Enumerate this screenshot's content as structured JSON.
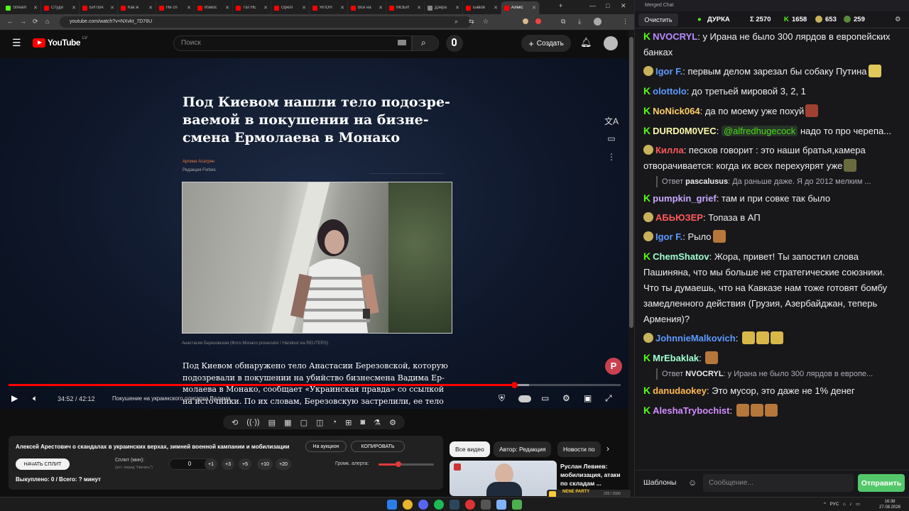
{
  "browser": {
    "tabs": [
      {
        "label": "Stream",
        "color": "#53fc18"
      },
      {
        "label": "Студи",
        "color": "#ff0000"
      },
      {
        "label": "БИТВА",
        "color": "#ff0000"
      },
      {
        "label": "Как ж",
        "color": "#ff0000"
      },
      {
        "label": "Не сп",
        "color": "#ff0000"
      },
      {
        "label": "Измос",
        "color": "#ff0000"
      },
      {
        "label": "ТЫ НЕ",
        "color": "#ff0000"
      },
      {
        "label": "Орелі",
        "color": "#ff0000"
      },
      {
        "label": "ЯПОН",
        "color": "#ff0000"
      },
      {
        "label": "Все на",
        "color": "#ff0000"
      },
      {
        "label": "МОБИ",
        "color": "#ff0000"
      },
      {
        "label": "Дзера",
        "color": "#888888"
      },
      {
        "label": "Бавов",
        "color": "#ff0000"
      },
      {
        "label": "Алекс",
        "color": "#ff0000",
        "active": true
      }
    ],
    "url": "youtube.com/watch?v=NXvkt_7D76U"
  },
  "youtube": {
    "logo_text": "YouTube",
    "logo_region": "LV",
    "search_placeholder": "Поиск",
    "create_label": "Создать"
  },
  "video": {
    "headline": "Под Киевом нашли тело подозре-ваемой в покушении на бизне-смена Ермолаева в Монако",
    "author": "Арпине Асатрян",
    "author_role": "Редакция Forbes",
    "photo_caption": "Анастасия Березовская (Фото Monaco prosecutor / Handout via REUTERS)",
    "body": "Под Киевом обнаружено тело Анастасии Березовской, которую подозревали в покушении на убийство бизнесмена Вадима Ер-молаева в Монако, сообщает «Украинская правда» со ссылкой на источники. По их словам, Березовскую застрелили, ее тело было",
    "badge_letter": "P",
    "time": "34:52 / 42:12",
    "chapter": "Покушение на украинского олигарха Вадима...",
    "progress_fraction": 0.826,
    "buffered_fraction": 0.85
  },
  "split": {
    "title": "Алексей Арестович о скандалах в украинских верхах, зимней военной кампании и мобилизации",
    "auction_label": "На аукцион",
    "copy_label": "КОПИРОВАТЬ",
    "start_label": "НАЧАТЬ СПЛИТ",
    "split_label": "Сплит (мин):",
    "split_hint": "(уст. перед \"Начать\")",
    "split_value": "0",
    "inc_buttons": [
      "+1",
      "+3",
      "+5",
      "+10",
      "+20"
    ],
    "alert_label": "Громк. алерта:",
    "alert_level": 0.36,
    "bought_text": "Выкуплено: 0 / Всего: ? минут"
  },
  "recommendations": {
    "chips": [
      "Все видео",
      "Автор: Редакция",
      "Новости по"
    ],
    "first_title": "Руслан Левиев: мобилизация, атаки по складам ..."
  },
  "chat": {
    "window_title": "Merged Chat",
    "clear_label": "Очистить",
    "stats": {
      "name": "ДУРКА",
      "sum": "Σ 2570",
      "k_count": "1658",
      "t_count": "653",
      "y_count": "259"
    },
    "messages": [
      {
        "badge": "k",
        "nick": "NVOCRYL",
        "color": "#b98cff",
        "text": "у Ирана не было 300 лярдов в европейских банках"
      },
      {
        "badge": "emote",
        "nick": "Igor F.",
        "color": "#5b9bff",
        "text": "первым делом зарезал бы собаку Путина",
        "emote": "#e0c85a"
      },
      {
        "badge": "k",
        "nick": "olottolo",
        "color": "#5b9bff",
        "text": "до третьей мировой 3, 2, 1"
      },
      {
        "badge": "k",
        "nick": "NoNick064",
        "color": "#ffcf66",
        "text": "да по моему уже похуй",
        "emote": "#a04030"
      },
      {
        "badge": "k",
        "nick": "DURD0M0VEC",
        "color": "#fff9a8",
        "text": "надо то про черепа...",
        "mention": "@alfredhugecock"
      },
      {
        "badge": "emote",
        "nick": "Килла",
        "color": "#ff5a5a",
        "text": "песков говорит : это наши братья,камера отворачивается: когда их всех перехуярят уже",
        "emote": "#6a6a40"
      },
      {
        "reply": "Ответ",
        "reply_nick": "pascalusus",
        "reply_text": "Да раньше даже. Я до 2012 мелким ..."
      },
      {
        "badge": "k",
        "nick": "pumpkin_grief",
        "color": "#c9a8ff",
        "text": "там и при совке так было"
      },
      {
        "badge": "emote",
        "nick": "АБЬЮЗЕР",
        "color": "#ff5a5a",
        "text": "Топаза в АП"
      },
      {
        "badge": "emote",
        "nick": "Igor F.",
        "color": "#5b9bff",
        "text": "Рыло",
        "emote": "#b5773a"
      },
      {
        "badge": "k",
        "nick": "ChemShatov",
        "color": "#9fffd0",
        "text": "Жора, привет! Ты запостил слова Пашиняна, что мы больше не стратегические союзники. Что ты думаешь, что на Кавказе нам тоже готовят бомбу замедленного действия (Грузия, Азербайджан, теперь Армения)?"
      },
      {
        "badge": "emote",
        "nick": "JohnnieMalkovich",
        "color": "#5b9bff",
        "text": "",
        "emotes": [
          "#d9b84a",
          "#d9b84a",
          "#d9b84a"
        ]
      },
      {
        "badge": "k",
        "nick": "MrEbaklak",
        "color": "#9fffd0",
        "text": "",
        "emotes": [
          "#b5773a"
        ]
      },
      {
        "reply": "Ответ",
        "reply_nick": "NVOCRYL",
        "reply_text": "у Ирана не было 300 лярдов в европе..."
      },
      {
        "badge": "k",
        "nick": "danudaokey",
        "color": "#ffb84d",
        "text": "Это мусор, это даже не 1% денег"
      },
      {
        "badge": "k",
        "nick": "AleshaTrybochist",
        "color": "#d48cff",
        "text": "",
        "emotes": [
          "#b5773a",
          "#b5773a",
          "#b5773a"
        ]
      }
    ],
    "templates_label": "Шаблоны",
    "input_placeholder": "Сообщение...",
    "send_label": "Отправить"
  },
  "taskbar": {
    "tray_lang": "РУС",
    "time": "16:38",
    "date": "27.08.2026",
    "banner": "NENE PARTY",
    "banner_sub": "225 / 1500"
  }
}
